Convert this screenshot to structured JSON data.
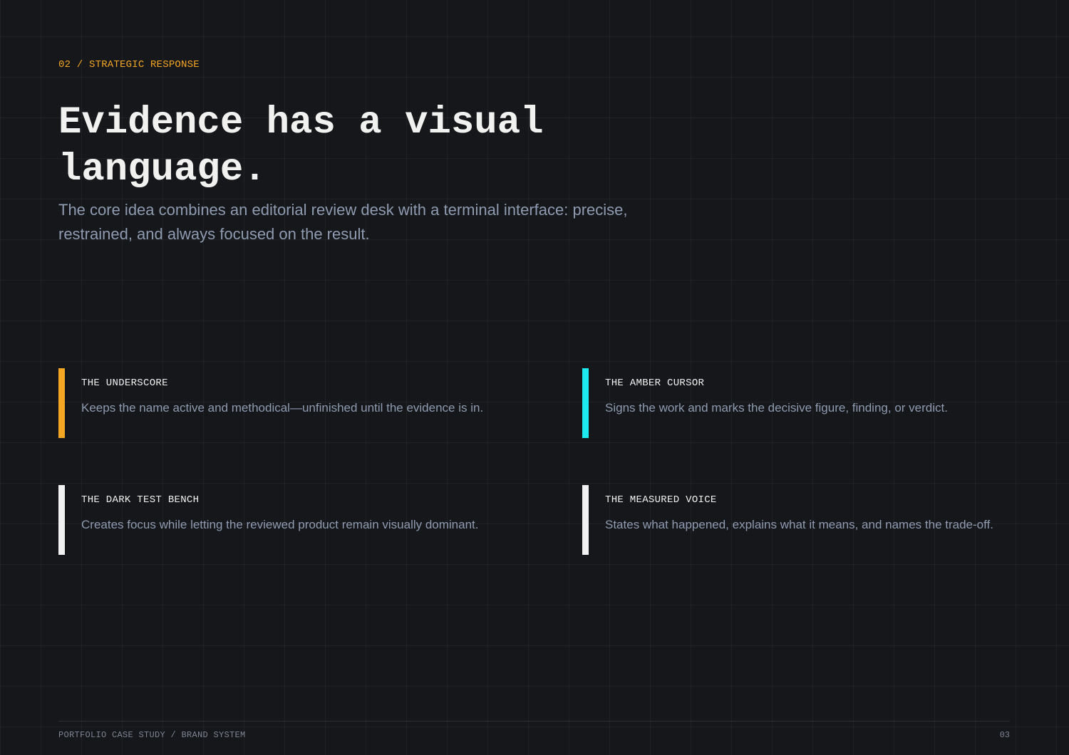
{
  "section": {
    "eyebrow": "02 / STRATEGIC RESPONSE",
    "headline": "Evidence has a visual language.",
    "subhead": "The core idea combines an editorial review desk with a terminal interface: precise, restrained, and always focused on the result."
  },
  "principles": [
    {
      "title": "THE UNDERSCORE",
      "description": "Keeps the name active and methodical—unfinished until the evidence is in.",
      "accent_color": "#f5a623"
    },
    {
      "title": "THE AMBER CURSOR",
      "description": "Signs the work and marks the decisive figure, finding, or verdict.",
      "accent_color": "#1de9f0"
    },
    {
      "title": "THE DARK TEST BENCH",
      "description": "Creates focus while letting the reviewed product remain visually dominant.",
      "accent_color": "#f1f1f1"
    },
    {
      "title": "THE MEASURED VOICE",
      "description": "States what happened, explains what it means, and names the trade-off.",
      "accent_color": "#f1f1f1"
    }
  ],
  "footer": {
    "label": "PORTFOLIO CASE STUDY / BRAND SYSTEM",
    "page_number": "03"
  }
}
